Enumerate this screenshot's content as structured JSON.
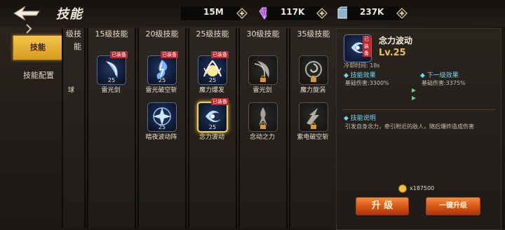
{
  "header": {
    "title": "技能",
    "resources": [
      {
        "name": "gold",
        "value": "15M"
      },
      {
        "name": "gem",
        "value": "117K"
      },
      {
        "name": "crystal",
        "value": "237K"
      }
    ]
  },
  "nav": {
    "items": [
      {
        "label": "技能",
        "active": true
      },
      {
        "label": "技能配置",
        "active": false
      }
    ]
  },
  "columns": [
    {
      "title": "级技能",
      "skills": [
        {
          "name": "球"
        }
      ]
    },
    {
      "title": "15级技能",
      "skills": [
        {
          "name": "雷光剑",
          "level": "25",
          "equipped": "已装备"
        }
      ]
    },
    {
      "title": "20级技能",
      "skills": [
        {
          "name": "雷光破空斩",
          "level": "25",
          "equipped": "已装备"
        },
        {
          "name": "暗夜波动阵",
          "level": "25"
        }
      ]
    },
    {
      "title": "25级技能",
      "skills": [
        {
          "name": "魔力爆发",
          "level": "25",
          "equipped": "已装备"
        },
        {
          "name": "念力波动",
          "level": "25",
          "equipped": "已装备",
          "selected": true
        }
      ]
    },
    {
      "title": "30级技能",
      "skills": [
        {
          "name": "雷光剑",
          "locked": true
        },
        {
          "name": "念动之力",
          "locked": true
        }
      ]
    },
    {
      "title": "35级技能",
      "skills": [
        {
          "name": "魔力旋涡",
          "locked": true
        },
        {
          "name": "紫电破空斩",
          "locked": true
        }
      ]
    }
  ],
  "detail": {
    "badge": "已装备",
    "name": "念力波动",
    "level": "Lv.25",
    "cooldown": "冷却时间: 18s",
    "current_effect_label": "技能效果",
    "current_effect": "基础伤害:3300%",
    "next_effect_label": "下一级效果",
    "next_effect": "基础伤害:3375%",
    "desc_label": "技能说明",
    "desc": "引发自身念力，牵引附近的敌人，随后爆炸造成伤害",
    "cost": "x187500",
    "upgrade_label": "升 级",
    "one_key_label": "一键升级"
  },
  "colors": {
    "accent": "#f0c040",
    "equipped": "#c5222a",
    "button": "#d65415",
    "effect": "#6fd7f2"
  }
}
